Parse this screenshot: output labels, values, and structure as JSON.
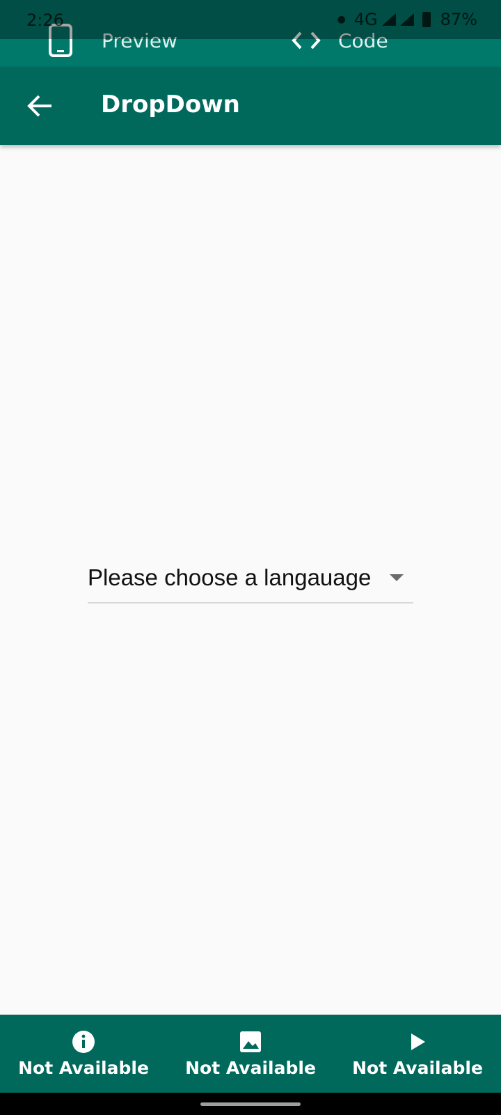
{
  "status_bar": {
    "time": "2:26",
    "network": "4G",
    "battery": "87%"
  },
  "top_tabs": {
    "preview_label": "Preview",
    "code_label": "Code",
    "preview_icon": "phone-icon",
    "code_icon": "code-brackets-icon"
  },
  "app_bar": {
    "title": "DropDown",
    "back_icon": "arrow-left-icon"
  },
  "dropdown": {
    "selected_text": "Please choose a langauage",
    "arrow_icon": "dropdown-triangle-icon"
  },
  "bottom_bar": {
    "items": [
      {
        "icon": "info-icon",
        "label": "Not Available"
      },
      {
        "icon": "image-icon",
        "label": "Not Available"
      },
      {
        "icon": "play-icon",
        "label": "Not Available"
      }
    ]
  },
  "colors": {
    "tab_bar": "#00796b",
    "app_bar": "#00695c",
    "background": "#fafafa"
  }
}
